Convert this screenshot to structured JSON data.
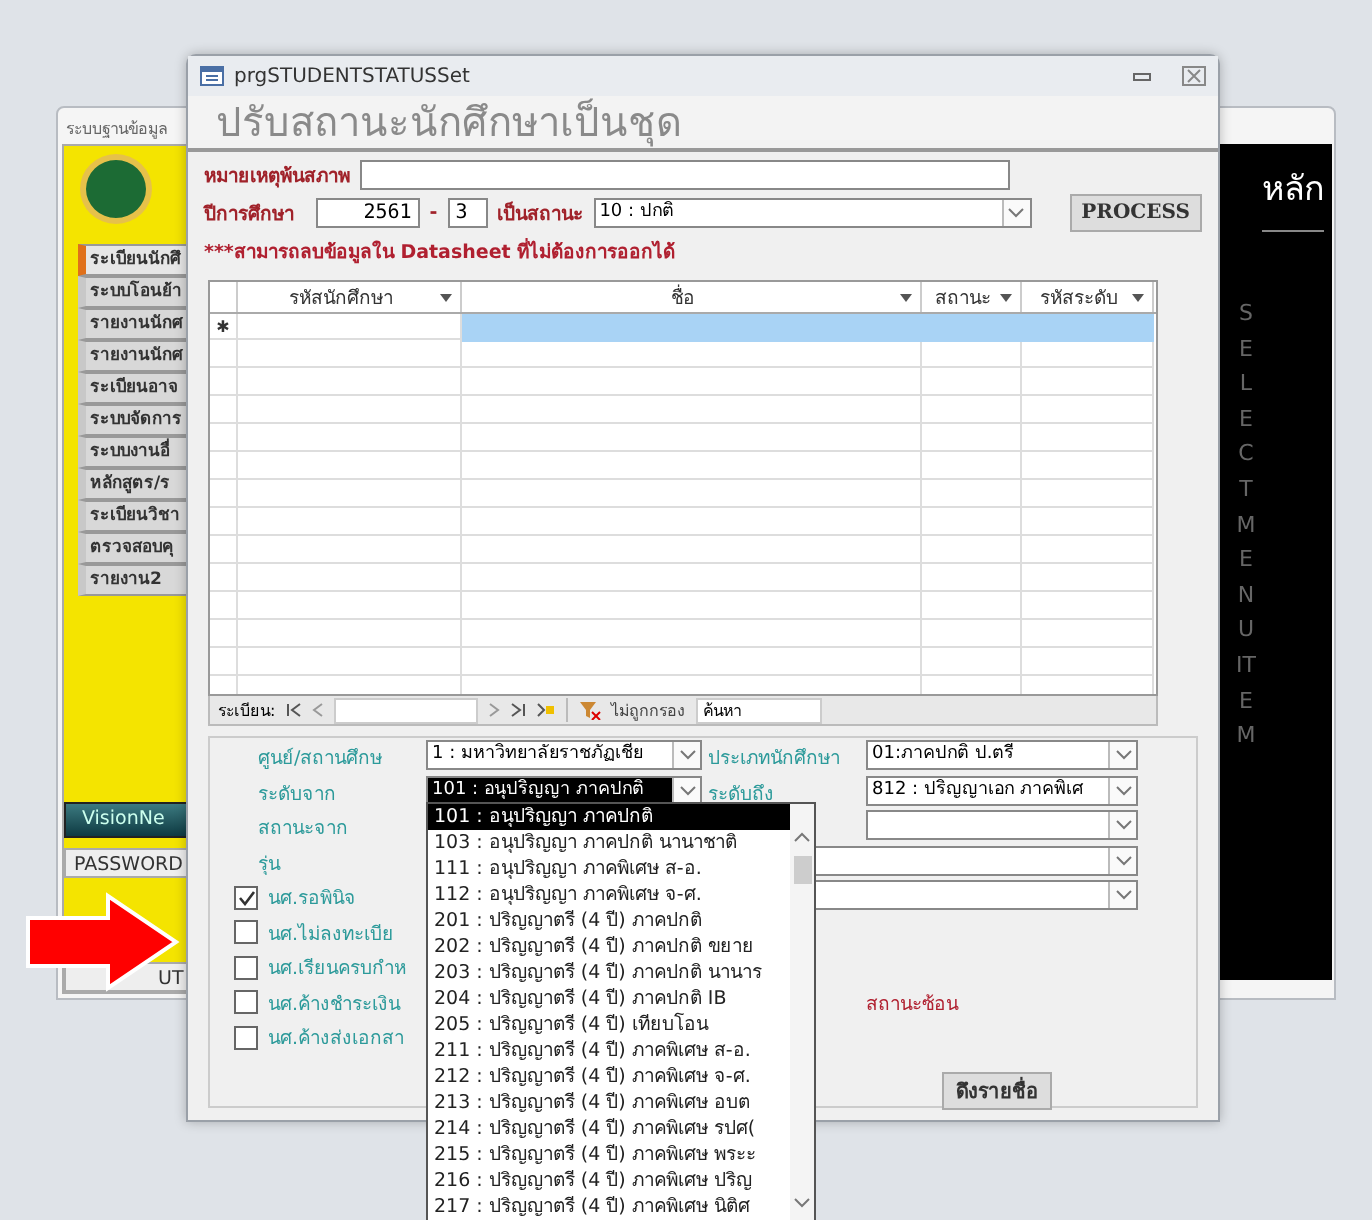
{
  "background_window": {
    "title": "ระบบฐานข้อมูล",
    "menu_items": [
      {
        "label": "ระเบียนนักศึ",
        "selected": true
      },
      {
        "label": "ระบบโอนย้า",
        "selected": false
      },
      {
        "label": "รายงานนักศ",
        "selected": false
      },
      {
        "label": "รายงานนักศ",
        "selected": false
      },
      {
        "label": "ระเบียนอาจ",
        "selected": false
      },
      {
        "label": "ระบบจัดการ",
        "selected": false
      },
      {
        "label": "ระบบงานอื่",
        "selected": false
      },
      {
        "label": "หลักสูตร/ร",
        "selected": false
      },
      {
        "label": "ระเบียนวิชา",
        "selected": false
      },
      {
        "label": "ตรวจสอบคุ",
        "selected": false
      },
      {
        "label": "รายงาน2",
        "selected": false
      }
    ],
    "banner": "VisionNe",
    "buttons": [
      "PASSWORD",
      "UT"
    ]
  },
  "menu_panel": {
    "title": "หลัก",
    "vertical_text": "SELECT MENU ITEM"
  },
  "dialog": {
    "title": "prgSTUDENTSTATUSSet",
    "heading": "ปรับสถานะนักศึกษาเป็นชุด",
    "remark_label": "หมายเหตุพ้นสภาพ",
    "year_label": "ปีการศึกษา",
    "year": "2561",
    "dash": "-",
    "term": "3",
    "status_label": "เป็นสถานะ",
    "status": "10 : ปกติ",
    "process_button": "PROCESS",
    "note": "***สามารถลบข้อมูลใน Datasheet ที่ไม่ต้องการออกได้",
    "table": {
      "columns": [
        "รหัสนักศึกษา",
        "ชื่อ",
        "สถานะ",
        "รหัสระดับ"
      ],
      "new_row_marker": "✱"
    },
    "navigator": {
      "label": "ระเบียน:",
      "filter": "ไม่ถูกกรอง",
      "search": "ค้นหา"
    },
    "filters": {
      "campus_label": "ศูนย์/สถานศึกษ",
      "campus": "1 : มหาวิทยาลัยราชภัฏเชีย",
      "type_label": "ประเภทนักศึกษา",
      "type": "01:ภาคปกติ ป.ตรี",
      "level_from_label": "ระดับจาก",
      "level_from": "101 : อนุปริญญา ภาคปกติ",
      "level_to_label": "ระดับถึง",
      "level_to": "812 : ปริญญาเอก ภาคพิเศ",
      "status_from_label": "สถานะจาก",
      "batch_label": "รุ่น"
    },
    "checkboxes": [
      {
        "label": "นศ.รอพินิจ",
        "checked": true
      },
      {
        "label": "นศ.ไม่ลงทะเบีย",
        "checked": false
      },
      {
        "label": "นศ.เรียนครบกำห",
        "checked": false
      },
      {
        "label": "นศ.ค้างชำระเงิน",
        "checked": false
      },
      {
        "label": "นศ.ค้างส่งเอกสา",
        "checked": false
      }
    ],
    "overlap_note": "สถานะซ้อน",
    "fetch_button": "ดึงรายชื่อ",
    "dropdown": [
      {
        "label": "101 : อนุปริญญา ภาคปกติ",
        "selected": true
      },
      {
        "label": "103 : อนุปริญญา ภาคปกติ นานาชาติ",
        "selected": false
      },
      {
        "label": "111 : อนุปริญญา ภาคพิเศษ ส-อ.",
        "selected": false
      },
      {
        "label": "112 : อนุปริญญา ภาคพิเศษ จ-ศ.",
        "selected": false
      },
      {
        "label": "201 : ปริญญาตรี (4 ปี) ภาคปกติ",
        "selected": false
      },
      {
        "label": "202 : ปริญญาตรี (4 ปี) ภาคปกติ ขยาย",
        "selected": false
      },
      {
        "label": "203 : ปริญญาตรี (4 ปี) ภาคปกติ นานาร",
        "selected": false
      },
      {
        "label": "204 : ปริญญาตรี (4 ปี) ภาคปกติ IB",
        "selected": false
      },
      {
        "label": "205 : ปริญญาตรี (4 ปี) เทียบโอน",
        "selected": false
      },
      {
        "label": "211 : ปริญญาตรี (4 ปี) ภาคพิเศษ ส-อ.",
        "selected": false
      },
      {
        "label": "212 : ปริญญาตรี (4 ปี) ภาคพิเศษ จ-ศ.",
        "selected": false
      },
      {
        "label": "213 : ปริญญาตรี (4 ปี) ภาคพิเศษ อบต",
        "selected": false
      },
      {
        "label": "214 : ปริญญาตรี (4 ปี) ภาคพิเศษ รปศ(",
        "selected": false
      },
      {
        "label": "215 : ปริญญาตรี (4 ปี) ภาคพิเศษ พระะ",
        "selected": false
      },
      {
        "label": "216 : ปริญญาตรี (4 ปี) ภาคพิเศษ ปริญ",
        "selected": false
      },
      {
        "label": "217 : ปริญญาตรี (4 ปี) ภาคพิเศษ นิติศ",
        "selected": false
      }
    ]
  }
}
